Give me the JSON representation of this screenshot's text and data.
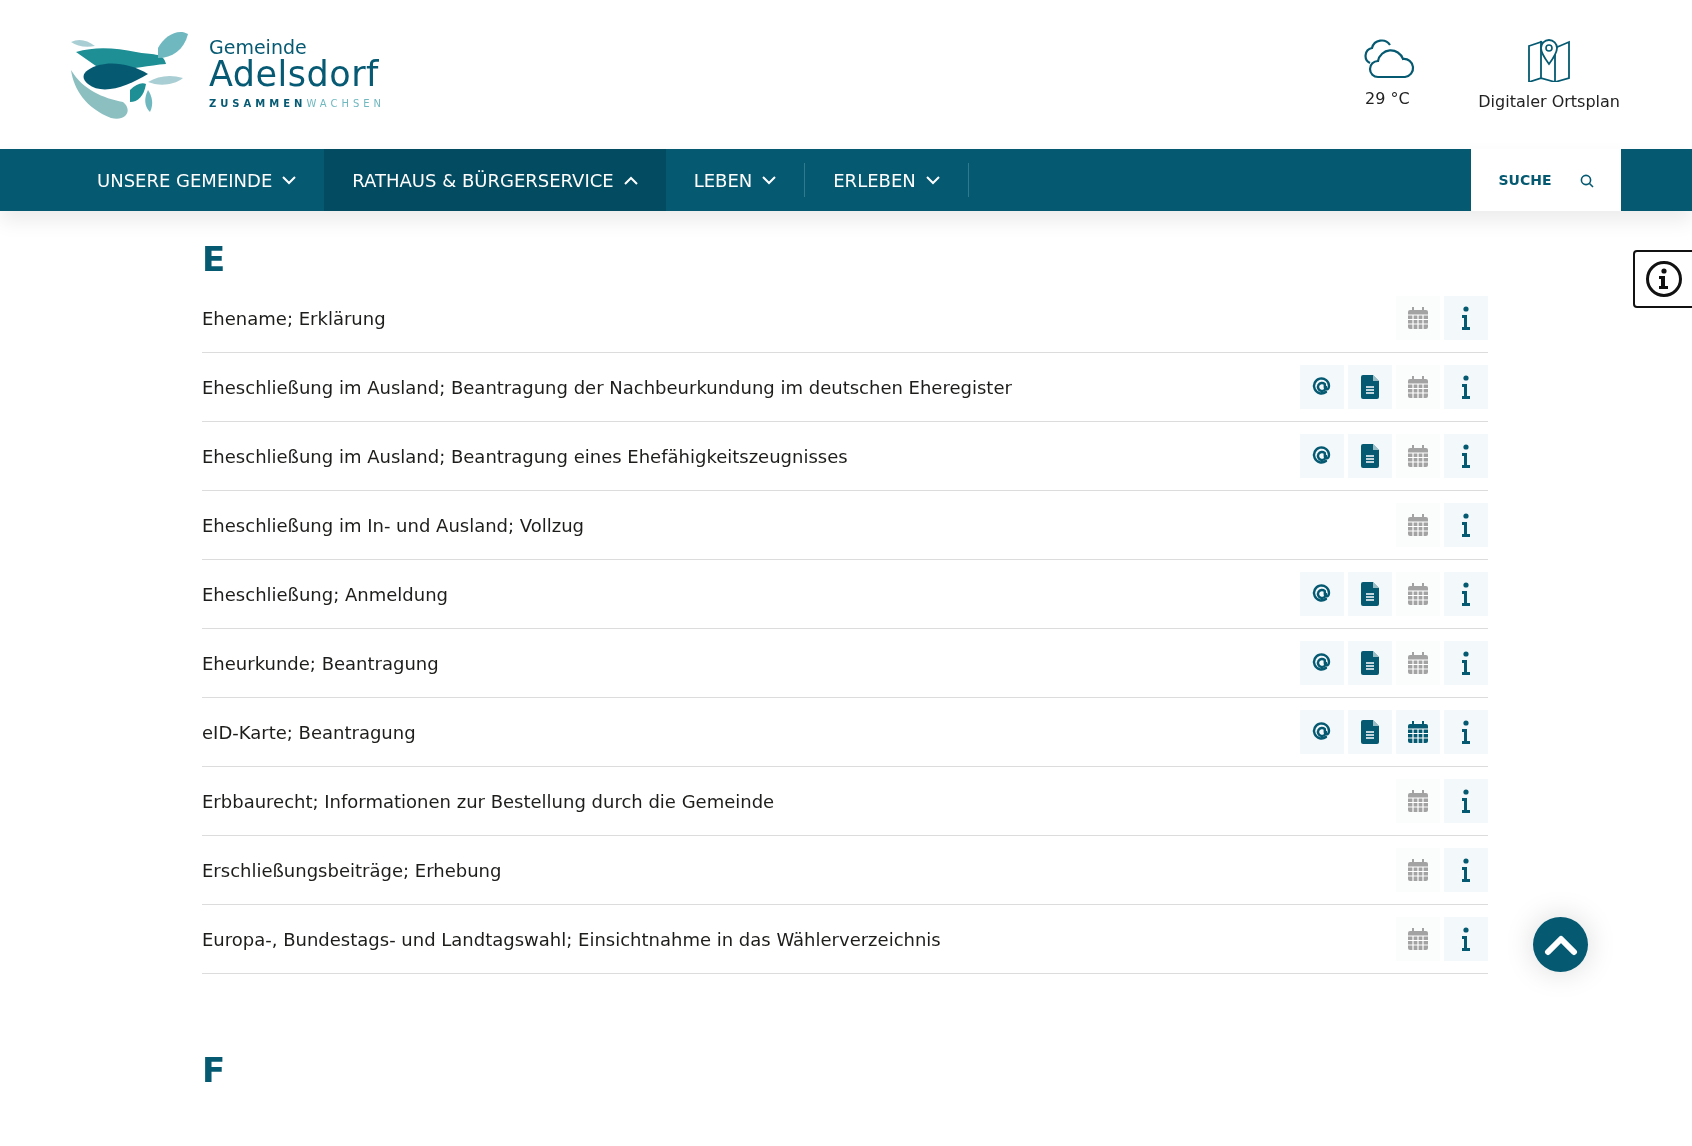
{
  "logo": {
    "line_1": "Gemeinde",
    "line_2": "Adelsdorf",
    "tagline": {
      "part_1": "ZUSAMMEN",
      "part_2": "WACHSEN"
    }
  },
  "weather": {
    "temperature": "29 °C"
  },
  "map_link": {
    "label": "Digitaler Ortsplan"
  },
  "nav": [
    {
      "label": "UNSERE GEMEINDE",
      "selected": false,
      "expanded": false
    },
    {
      "label": "RATHAUS & BÜRGERSERVICE",
      "selected": true,
      "expanded": true
    },
    {
      "label": "LEBEN",
      "selected": false,
      "expanded": false
    },
    {
      "label": "ERLEBEN",
      "selected": false,
      "expanded": false
    }
  ],
  "search": {
    "label": "SUCHE"
  },
  "sections": [
    {
      "letter": "E",
      "rows": [
        {
          "title": "Ehename; Erklärung",
          "actions": [
            {
              "kind": "calendar",
              "disabled": true
            },
            {
              "kind": "info",
              "disabled": false
            }
          ]
        },
        {
          "title": "Eheschließung im Ausland; Beantragung der Nachbeurkundung im deutschen Eheregister",
          "actions": [
            {
              "kind": "email",
              "disabled": false
            },
            {
              "kind": "form",
              "disabled": false
            },
            {
              "kind": "calendar",
              "disabled": true
            },
            {
              "kind": "info",
              "disabled": false
            }
          ]
        },
        {
          "title": "Eheschließung im Ausland; Beantragung eines Ehefähigkeitszeugnisses",
          "actions": [
            {
              "kind": "email",
              "disabled": false
            },
            {
              "kind": "form",
              "disabled": false
            },
            {
              "kind": "calendar",
              "disabled": true
            },
            {
              "kind": "info",
              "disabled": false
            }
          ]
        },
        {
          "title": "Eheschließung im In- und Ausland; Vollzug",
          "actions": [
            {
              "kind": "calendar",
              "disabled": true
            },
            {
              "kind": "info",
              "disabled": false
            }
          ]
        },
        {
          "title": "Eheschließung; Anmeldung",
          "actions": [
            {
              "kind": "email",
              "disabled": false
            },
            {
              "kind": "form",
              "disabled": false
            },
            {
              "kind": "calendar",
              "disabled": true
            },
            {
              "kind": "info",
              "disabled": false
            }
          ]
        },
        {
          "title": "Eheurkunde; Beantragung",
          "actions": [
            {
              "kind": "email",
              "disabled": false
            },
            {
              "kind": "form",
              "disabled": false
            },
            {
              "kind": "calendar",
              "disabled": true
            },
            {
              "kind": "info",
              "disabled": false
            }
          ]
        },
        {
          "title": "eID-Karte; Beantragung",
          "actions": [
            {
              "kind": "email",
              "disabled": false
            },
            {
              "kind": "form",
              "disabled": false
            },
            {
              "kind": "calendar",
              "disabled": false
            },
            {
              "kind": "info",
              "disabled": false
            }
          ]
        },
        {
          "title": "Erbbaurecht; Informationen zur Bestellung durch die Gemeinde",
          "actions": [
            {
              "kind": "calendar",
              "disabled": true
            },
            {
              "kind": "info",
              "disabled": false
            }
          ]
        },
        {
          "title": "Erschließungsbeiträge; Erhebung",
          "actions": [
            {
              "kind": "calendar",
              "disabled": true
            },
            {
              "kind": "info",
              "disabled": false
            }
          ]
        },
        {
          "title": "Europa-, Bundestags- und Landtagswahl; Einsichtnahme in das Wählerverzeichnis",
          "actions": [
            {
              "kind": "calendar",
              "disabled": true
            },
            {
              "kind": "info",
              "disabled": false
            }
          ]
        }
      ]
    },
    {
      "letter": "F"
    }
  ]
}
